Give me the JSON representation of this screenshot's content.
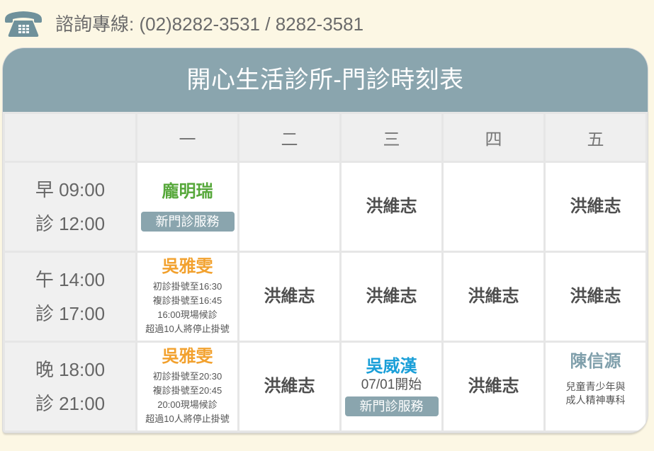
{
  "contact": {
    "icon": "telephone-icon",
    "label": "諮詢專線: (02)8282-3531 / 8282-3581"
  },
  "colors": {
    "page_bg": "#fcf7e4",
    "header_bg": "#8aa5ae",
    "badge_bg": "#8aa5ae",
    "doctor_default": "#4f4f4f",
    "green": "#57a83b",
    "orange": "#f2a12e",
    "blue": "#1a9fd8",
    "slate": "#7f9fab"
  },
  "schedule": {
    "title": "開心生活診所-門診時刻表",
    "days": [
      "一",
      "二",
      "三",
      "四",
      "五"
    ],
    "sessions": [
      {
        "time_lines": [
          "早 09:00",
          "診 12:00"
        ],
        "cells": [
          {
            "doctor": "龐明瑞",
            "color": "#57a83b",
            "badge": "新門診服務"
          },
          {},
          {
            "doctor": "洪維志"
          },
          {},
          {
            "doctor": "洪維志"
          }
        ]
      },
      {
        "time_lines": [
          "午 14:00",
          "診 17:00"
        ],
        "cells": [
          {
            "doctor": "吳雅雯",
            "color": "#f2a12e",
            "notes": [
              "初診掛號至16:30",
              "複診掛號至16:45",
              "16:00現場候診",
              "超過10人將停止掛號"
            ]
          },
          {
            "doctor": "洪維志"
          },
          {
            "doctor": "洪維志"
          },
          {
            "doctor": "洪維志"
          },
          {
            "doctor": "洪維志"
          }
        ]
      },
      {
        "time_lines": [
          "晚 18:00",
          "診 21:00"
        ],
        "cells": [
          {
            "doctor": "吳雅雯",
            "color": "#f2a12e",
            "notes": [
              "初診掛號至20:30",
              "複診掛號至20:45",
              "20:00現場候診",
              "超過10人將停止掛號"
            ]
          },
          {
            "doctor": "洪維志"
          },
          {
            "doctor": "吳威漢",
            "color": "#1a9fd8",
            "note": "07/01開始",
            "badge": "新門診服務"
          },
          {
            "doctor": "洪維志"
          },
          {
            "doctor": "陳信源",
            "color": "#7f9fab",
            "notes": [
              "兒童青少年與",
              "成人精神專科"
            ]
          }
        ]
      }
    ]
  }
}
